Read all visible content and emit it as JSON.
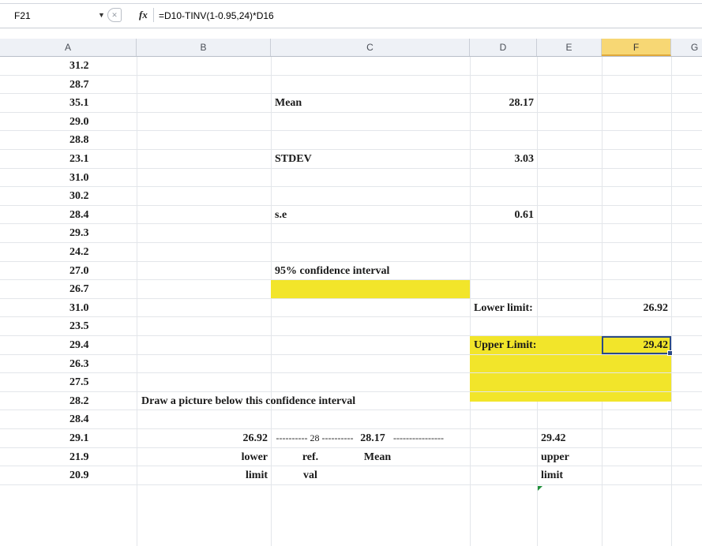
{
  "formula_bar": {
    "name_box": "F21",
    "fx_label": "fx",
    "formula": "=D10-TINV(1-0.95,24)*D16"
  },
  "columns": [
    "A",
    "B",
    "C",
    "D",
    "E",
    "F",
    "G"
  ],
  "selected_column": "F",
  "colors": {
    "highlight": "#f2e52a",
    "selection_border": "#2b4a86",
    "header_bg": "#eef1f6",
    "selected_header": "#f7d774"
  },
  "column_a": [
    "31.2",
    "28.7",
    "35.1",
    "29.0",
    "28.8",
    "23.1",
    "31.0",
    "30.2",
    "28.4",
    "29.3",
    "24.2",
    "27.0",
    "26.7",
    "31.0",
    "23.5",
    "29.4",
    "26.3",
    "27.5",
    "28.2",
    "28.4",
    "29.1",
    "21.9",
    "20.9"
  ],
  "cells": {
    "mean_label": "Mean",
    "mean_value": "28.17",
    "stdev_label": "STDEV",
    "stdev_value": "3.03",
    "se_label": "s.e",
    "se_value": "0.61",
    "ci_label": "95% confidence interval",
    "lower_label": "Lower limit:",
    "lower_value": "26.92",
    "upper_label": "Upper Limit:",
    "upper_value": "29.42",
    "draw_note": "Draw a picture below this confidence interval",
    "line_lower": "26.92",
    "line_dash1": "---------- 28 ----------",
    "line_mean": "28.17",
    "line_dash2": "----------------",
    "line_upper": "29.42",
    "word_lower": "lower",
    "word_ref": "ref.",
    "word_mean": "Mean",
    "word_upper": "upper",
    "word_limit1": "limit",
    "word_val": "val",
    "word_limit2": "limit"
  }
}
